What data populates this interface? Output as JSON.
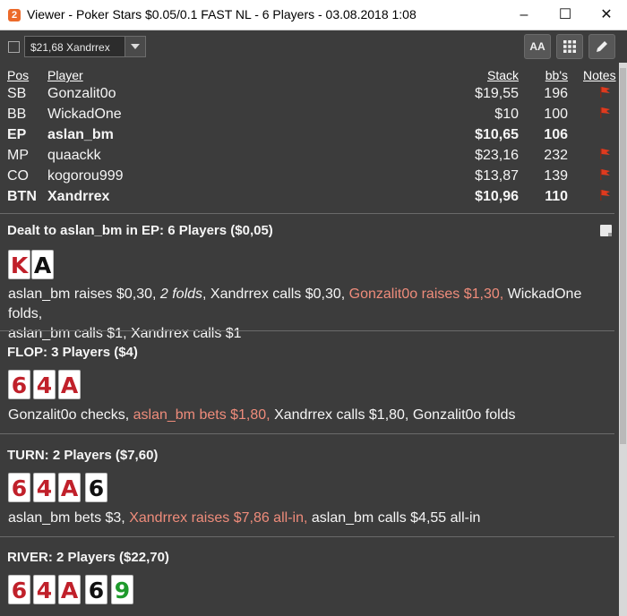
{
  "window": {
    "title": "Viewer - Poker Stars $0.05/0.1 FAST NL - 6 Players - 03.08.2018 1:08",
    "app_icon": "2",
    "controls": {
      "minimize": "–",
      "maximize": "☐",
      "close": "✕"
    }
  },
  "toolbar": {
    "player_select": "$21,68 Xandrrex",
    "font_button": "AA",
    "grid_icon": "grid-icon",
    "edit_icon": "pencil-icon"
  },
  "table": {
    "headers": {
      "pos": "Pos",
      "player": "Player",
      "stack": "Stack",
      "bbs": "bb's",
      "notes": "Notes"
    },
    "rows": [
      {
        "pos": "SB",
        "player": "Gonzalit0o",
        "stack": "$19,55",
        "bbs": "196",
        "note": true,
        "bold": false
      },
      {
        "pos": "BB",
        "player": "WickadOne",
        "stack": "$10",
        "bbs": "100",
        "note": true,
        "bold": false
      },
      {
        "pos": "EP",
        "player": "aslan_bm",
        "stack": "$10,65",
        "bbs": "106",
        "note": false,
        "bold": true
      },
      {
        "pos": "MP",
        "player": "quaackk",
        "stack": "$23,16",
        "bbs": "232",
        "note": true,
        "bold": false
      },
      {
        "pos": "CO",
        "player": "kogorou999",
        "stack": "$13,87",
        "bbs": "139",
        "note": true,
        "bold": false
      },
      {
        "pos": "BTN",
        "player": "Xandrrex",
        "stack": "$10,96",
        "bbs": "110",
        "note": true,
        "bold": true
      }
    ]
  },
  "preflop": {
    "title": "Dealt to aslan_bm in EP: 6 Players ($0,05)",
    "cards": [
      "K",
      "A"
    ],
    "actions": {
      "a1": "aslan_bm raises $0,30, ",
      "a2": "2 folds",
      "a3": ", Xandrrex calls $0,30, ",
      "a4": "Gonzalit0o raises $1,30,",
      "a5": " WickadOne folds,",
      "a6": "aslan_bm calls $1, Xandrrex calls $1"
    }
  },
  "flop": {
    "title": "FLOP: 3 Players ($4)",
    "cards": [
      "6",
      "4",
      "A"
    ],
    "actions": {
      "a1": "Gonzalit0o checks, ",
      "a2": "aslan_bm bets $1,80,",
      "a3": " Xandrrex calls $1,80, Gonzalit0o folds"
    }
  },
  "turn": {
    "title": "TURN: 2 Players ($7,60)",
    "cards": [
      "6",
      "4",
      "A",
      "6"
    ],
    "actions": {
      "a1": "aslan_bm bets $3, ",
      "a2": "Xandrrex raises $7,86 all-in,",
      "a3": " aslan_bm calls $4,55 all-in"
    }
  },
  "river": {
    "title": "RIVER: 2 Players ($22,70)",
    "cards": [
      "6",
      "4",
      "A",
      "6",
      "9"
    ]
  },
  "colors": {
    "background": "#3c3c3c",
    "highlight_action": "#ef8c7b",
    "red_suit": "#c0202a",
    "black_suit": "#111111",
    "green_suit": "#1e9a2c",
    "flag": "#e03a1e"
  }
}
